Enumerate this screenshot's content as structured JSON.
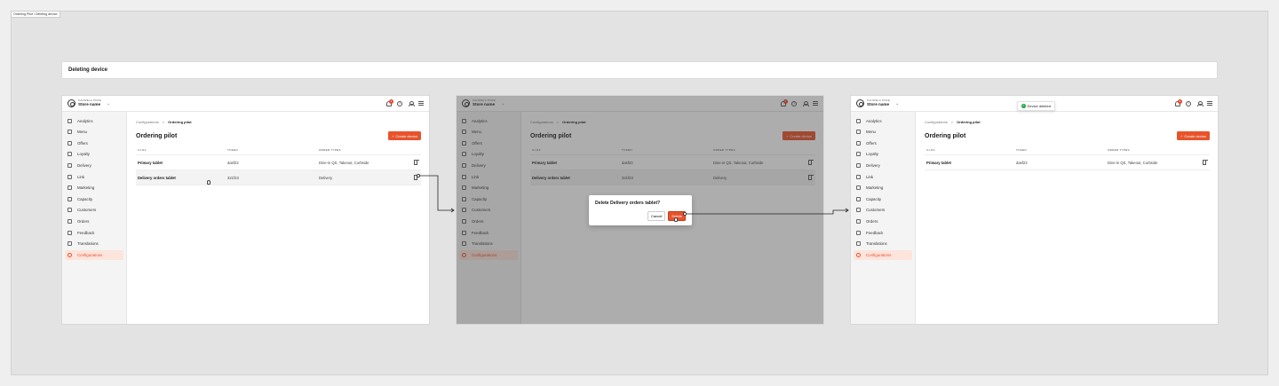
{
  "board": {
    "tag": "Ordering Pilot / Deleting device"
  },
  "banner": {
    "title": "Deleting device"
  },
  "brand": {
    "top": "KAUWELA POKE",
    "name": "Store name"
  },
  "topbar": {
    "notification_count": "2",
    "help": "?"
  },
  "sidebar": {
    "items": [
      {
        "label": "Analytics",
        "icon": "chart-icon"
      },
      {
        "label": "Menu",
        "icon": "utensils-icon"
      },
      {
        "label": "Offers",
        "icon": "percent-icon"
      },
      {
        "label": "Loyalty",
        "icon": "crown-icon"
      },
      {
        "label": "Delivery",
        "icon": "truck-icon"
      },
      {
        "label": "Link",
        "icon": "link-icon"
      },
      {
        "label": "Marketing",
        "icon": "megaphone-icon"
      },
      {
        "label": "Capacity",
        "icon": "gauge-icon"
      },
      {
        "label": "Customers",
        "icon": "customers-icon"
      },
      {
        "label": "Orders",
        "icon": "orders-icon"
      },
      {
        "label": "Feedback",
        "icon": "thumbs-up-icon"
      },
      {
        "label": "Translations",
        "icon": "translate-icon"
      },
      {
        "label": "Configurations",
        "icon": "gear-icon"
      }
    ]
  },
  "breadcrumb": {
    "parent": "Configurations",
    "sep": ">",
    "current": "Ordering pilot"
  },
  "page": {
    "title": "Ordering pilot",
    "create_button": "Create device",
    "plus": "+"
  },
  "table": {
    "headers": {
      "name": "NAME",
      "token": "TOKEN",
      "order_types": "ORDER TYPES"
    },
    "rows": [
      {
        "name": "Primary tablet",
        "token": "dasf23",
        "order_types": "Dine-in QS, Takeout, Curbside"
      },
      {
        "name": "Delivery orders tablet",
        "token": "321f23",
        "order_types": "Delivery"
      }
    ]
  },
  "dialog": {
    "title": "Delete Delivery orders tablet?",
    "cancel": "Cancel",
    "delete": "Delete"
  },
  "toast": {
    "text": "Device deleted",
    "check": "✓"
  },
  "colors": {
    "accent": "#e8532c",
    "success": "#2fa84f"
  }
}
